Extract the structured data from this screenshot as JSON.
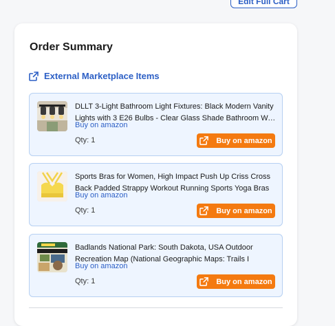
{
  "header": {
    "edit_cart_label": "Edit Full Cart"
  },
  "summary": {
    "title": "Order Summary",
    "section_label": "External Marketplace Items",
    "items": [
      {
        "title": "DLLT 3-Light Bathroom Light Fixtures: Black Modern Vanity Lights with 3 E26 Bulbs - Clear Glass Shade Bathroom Wall Lights",
        "source": "Buy on amazon",
        "qty": "Qty: 1",
        "button": "Buy on amazon",
        "thumb_icon": "vanity-light-thumbnail"
      },
      {
        "title": "Sports Bras for Women, High Impact Push Up Criss Cross Back Padded Strappy Workout Running Sports Yoga Bras",
        "source": "Buy on amazon",
        "qty": "Qty: 1",
        "button": "Buy on amazon",
        "thumb_icon": "sports-bra-thumbnail"
      },
      {
        "title": "Badlands National Park: South Dakota, USA Outdoor Recreation Map (National Geographic Maps: Trails I",
        "source": "Buy on amazon",
        "qty": "Qty: 1",
        "button": "Buy on amazon",
        "thumb_icon": "map-thumbnail"
      }
    ]
  },
  "colors": {
    "accent": "#2c5fc5",
    "buy_button": "#f47a10",
    "item_bg": "#eef5ff",
    "item_border": "#b6d0f2"
  }
}
